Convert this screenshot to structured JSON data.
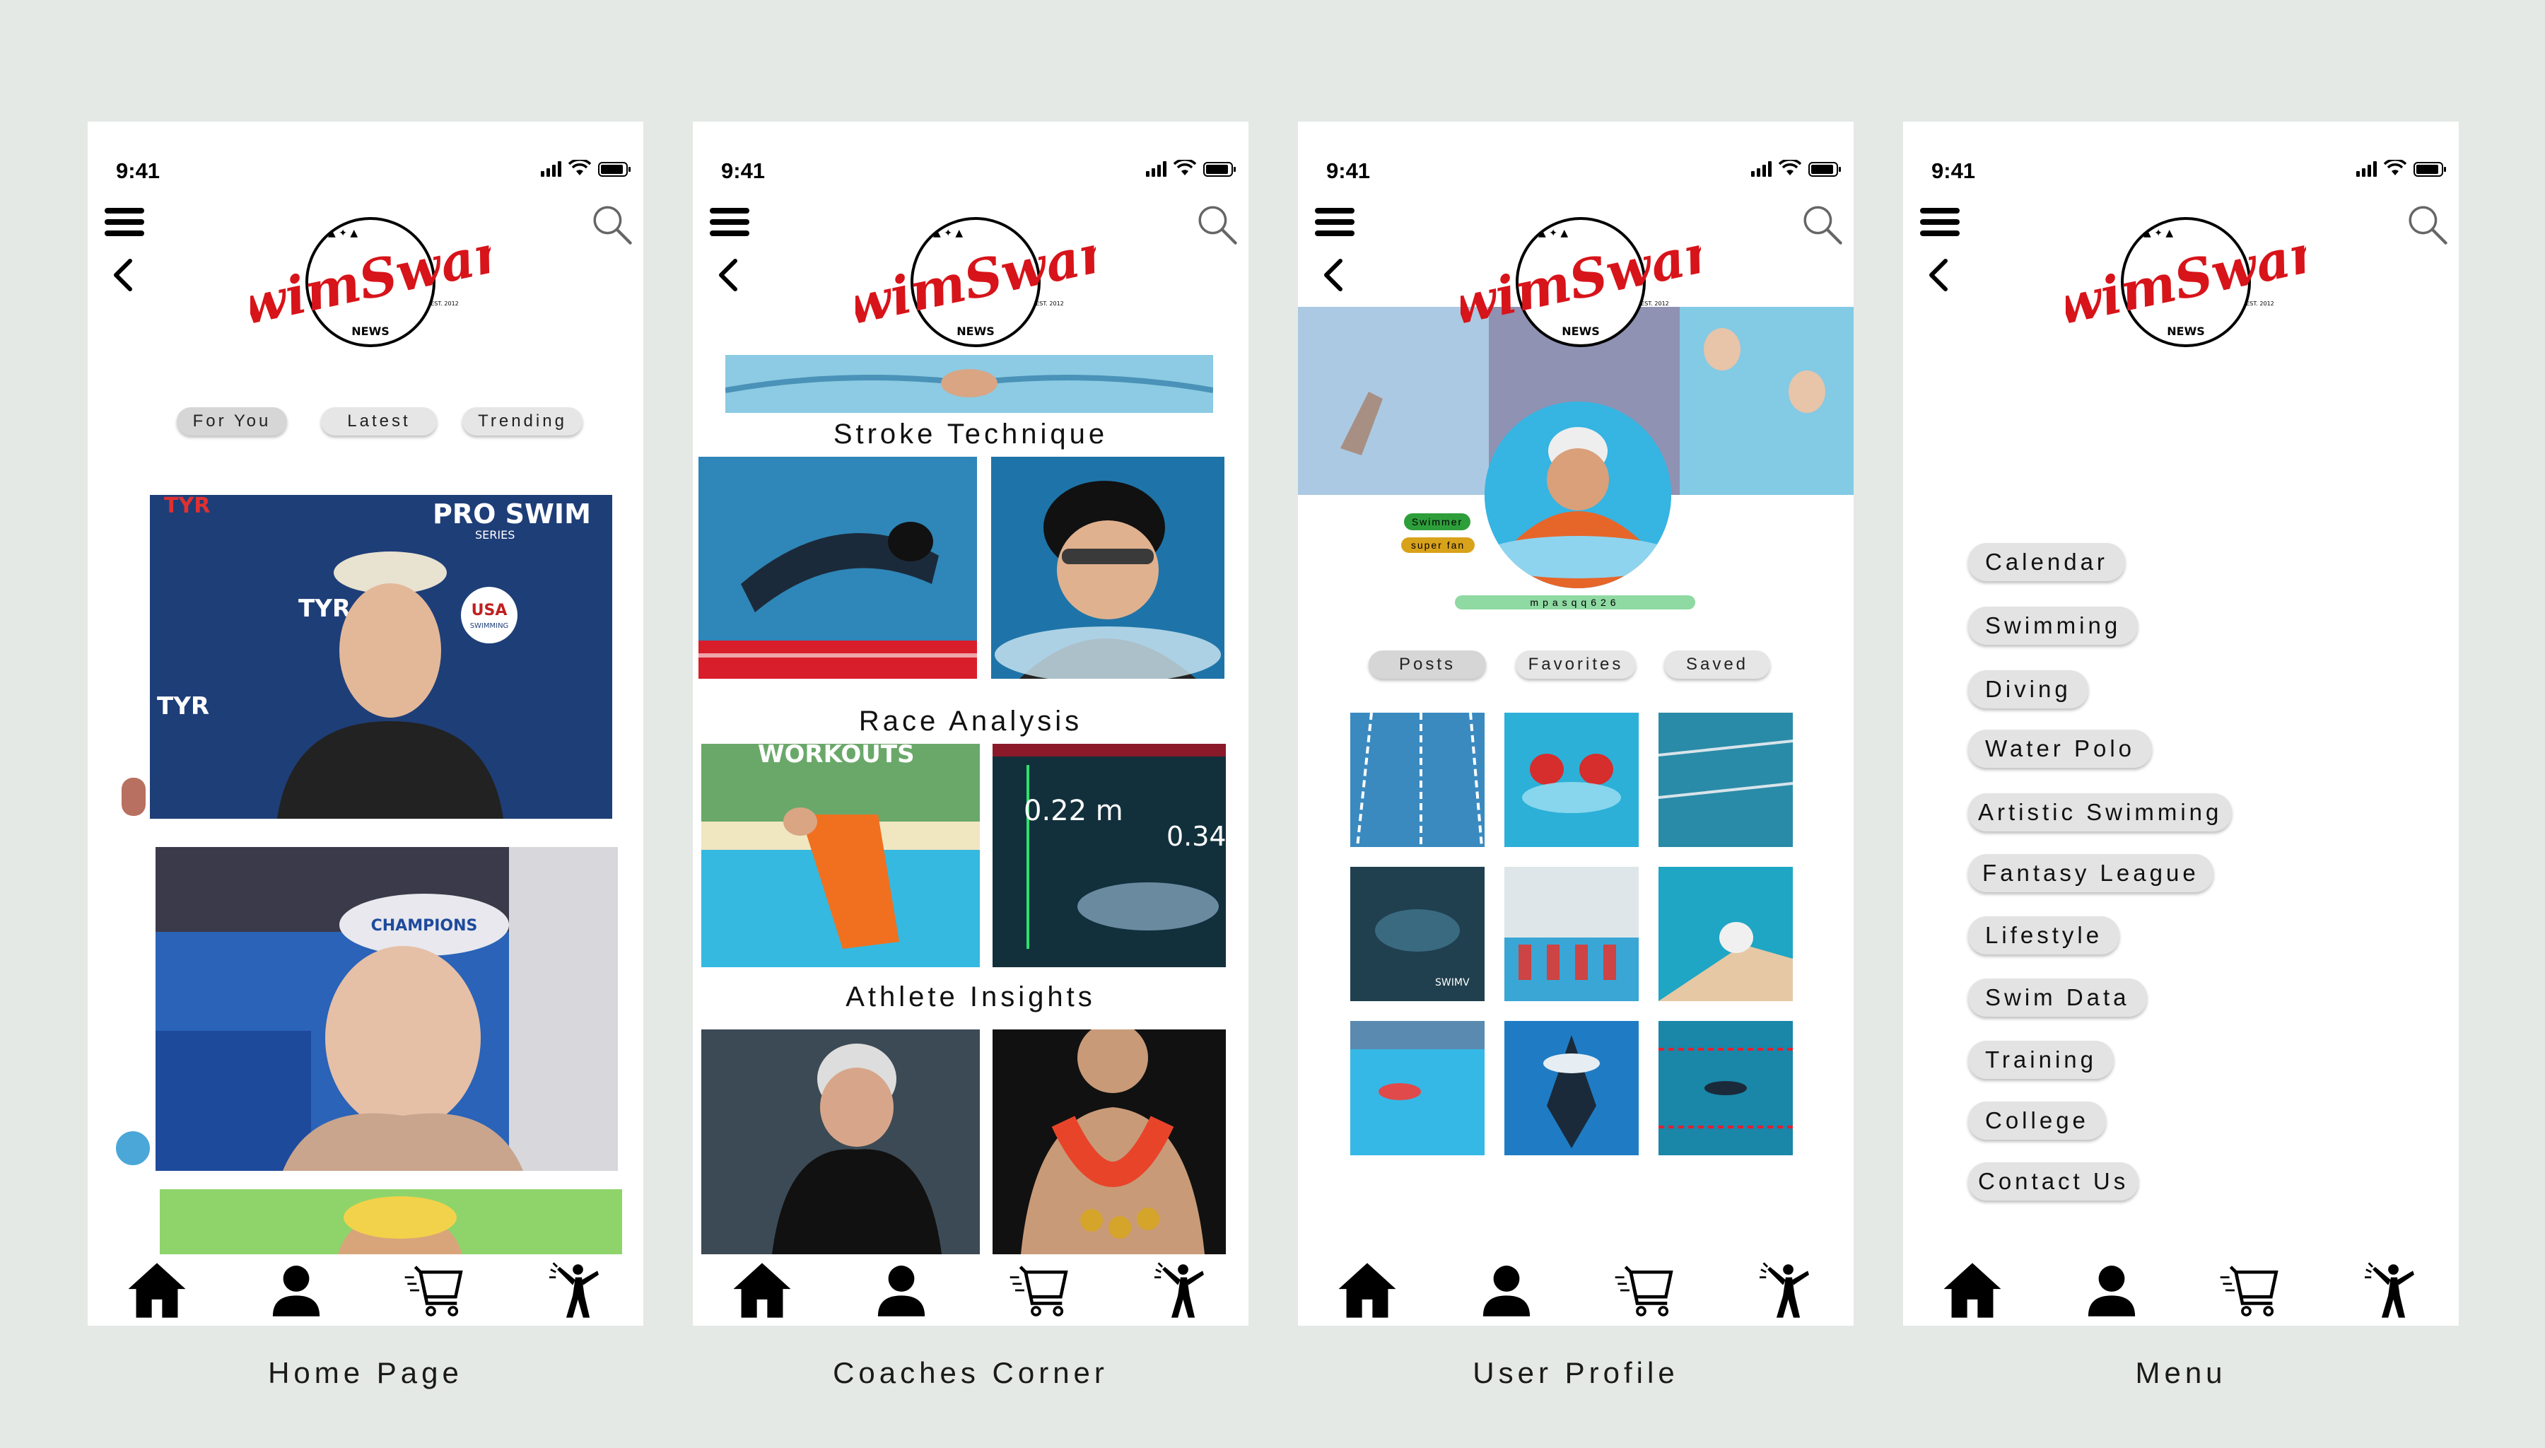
{
  "status": {
    "time": "9:41"
  },
  "brand": {
    "name_part1": "Swim",
    "name_part2": "Swam",
    "news": "NEWS",
    "est": "EST. 2012",
    "color": "#d7141a"
  },
  "screens": {
    "home": {
      "caption": "Home Page",
      "tabs": [
        "For You",
        "Latest",
        "Trending"
      ],
      "feed_overlay": {
        "pro_swim": "PRO SWIM",
        "series": "SERIES",
        "usa": "USA",
        "swimming": "SWIMMING",
        "tyr": "TYR",
        "champions": "CHAMPIONS"
      }
    },
    "coaches": {
      "caption": "Coaches Corner",
      "sections": [
        "Stroke Technique",
        "Race Analysis",
        "Athlete Insights"
      ],
      "workouts_label": "WORKOUTS",
      "measure_1": "0.22 m",
      "measure_2": "0.34"
    },
    "profile": {
      "caption": "User Profile",
      "badges": [
        "Swimmer",
        "super fan"
      ],
      "username": "mpasqq626",
      "tabs": [
        "Posts",
        "Favorites",
        "Saved"
      ],
      "watermark": "SWIMV"
    },
    "menu": {
      "caption": "Menu",
      "items": [
        "Calendar",
        "Swimming",
        "Diving",
        "Water Polo",
        "Artistic Swimming",
        "Fantasy League",
        "Lifestyle",
        "Swim Data",
        "Training",
        "College",
        "Contact Us"
      ]
    }
  },
  "icons": {
    "menu": "hamburger-icon",
    "back": "chevron-left-icon",
    "search": "search-icon",
    "nav": [
      "home-icon",
      "profile-icon",
      "cart-icon",
      "cheer-icon"
    ]
  },
  "colors": {
    "background": "#e4e9e5",
    "pill": "#e6e6e6",
    "pool": "#2aa8d8",
    "badge_green": "#2e9e3a",
    "badge_gold": "#d9a21b",
    "username_bar": "#8fd9a3"
  }
}
